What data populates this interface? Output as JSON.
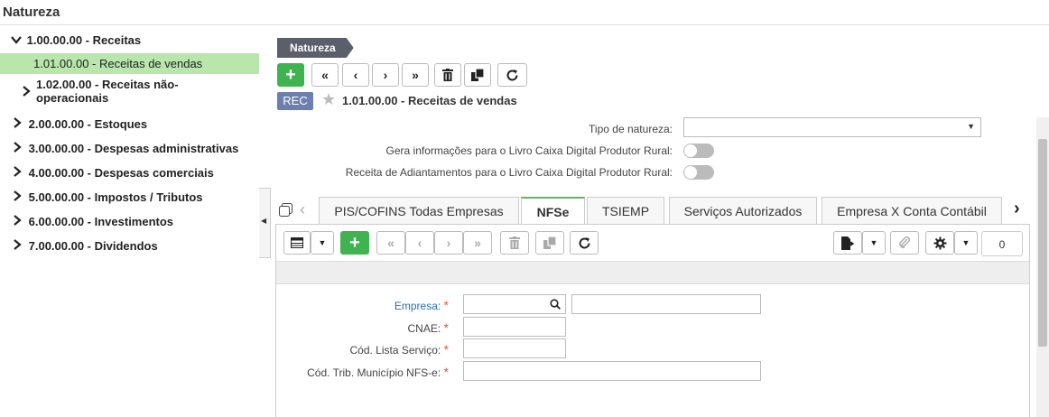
{
  "window": {
    "title": "Natureza"
  },
  "tree": {
    "items": [
      {
        "label": "1.00.00.00 - Receitas",
        "arrow": "⌄"
      },
      {
        "label": "1.01.00.00 - Receitas de vendas"
      },
      {
        "label": "1.02.00.00 - Receitas não-",
        "label2": "operacionais",
        "arrow": "›"
      },
      {
        "label": "2.00.00.00 - Estoques",
        "arrow": "›"
      },
      {
        "label": "3.00.00.00 - Despesas administrativas",
        "arrow": "›"
      },
      {
        "label": "4.00.00.00 - Despesas comerciais",
        "arrow": "›"
      },
      {
        "label": "5.00.00.00 - Impostos / Tributos",
        "arrow": "›"
      },
      {
        "label": "6.00.00.00 - Investimentos",
        "arrow": "›"
      },
      {
        "label": "7.00.00.00 - Dividendos",
        "arrow": "›"
      }
    ]
  },
  "breadcrumb": {
    "label": "Natureza"
  },
  "toolbar": {
    "add": "+",
    "first": "«",
    "prev": "‹",
    "next": "›",
    "last": "»"
  },
  "record": {
    "badge": "REC",
    "title": "1.01.00.00 - Receitas de vendas"
  },
  "form": {
    "tipo_label": "Tipo de natureza:",
    "tipo_value": "",
    "livro_label": "Gera informações para o Livro Caixa Digital Produtor Rural:",
    "adiant_label": "Receita de Adiantamentos para o Livro Caixa Digital Produtor Rural:"
  },
  "tabs": [
    "PIS/COFINS Todas Empresas",
    "NFSe",
    "TSIEMP",
    "Serviços Autorizados",
    "Empresa X Conta Contábil"
  ],
  "subtoolbar": {
    "counter": "0"
  },
  "nfse": {
    "empresa_label": "Empresa:",
    "cnae_label": "CNAE:",
    "lista_label": "Cód. Lista Serviço:",
    "trib_label": "Cód. Trib. Município NFS-e:",
    "required": "*"
  },
  "colors": {
    "accent_green": "#3fb34f",
    "selected_row": "#b9e6ad",
    "rec_badge": "#6d7fae",
    "link_blue": "#2a6ebb"
  }
}
